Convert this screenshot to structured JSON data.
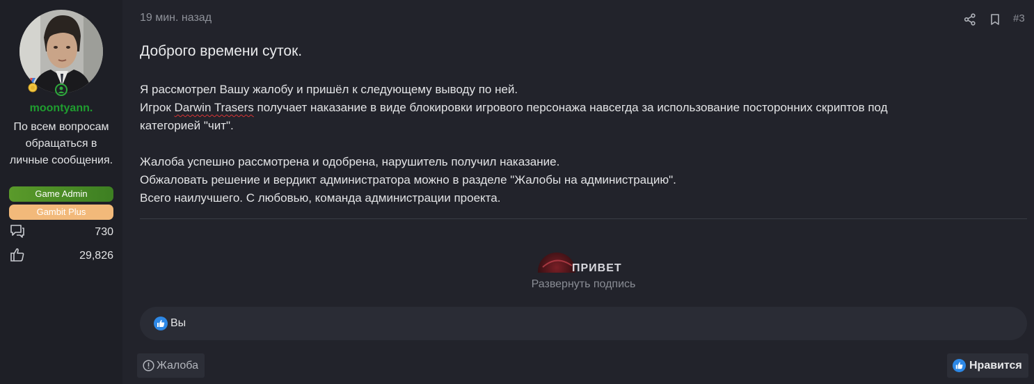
{
  "user": {
    "username": "moontyann.",
    "title": "По всем вопросам обращаться в личные сообщения.",
    "banners": {
      "admin": "Game Admin",
      "plus": "Gambit Plus"
    },
    "stats": {
      "messages": "730",
      "reactions": "29,826"
    },
    "colors": {
      "username": "#1f9d2f",
      "admin_banner": "#4a8c26",
      "plus_banner": "#f2b97a"
    }
  },
  "post": {
    "date": "19 мин. назад",
    "number": "#3",
    "greeting": "Доброго времени суток.",
    "line1": "Я рассмотрел Вашу жалобу и пришёл к следующему выводу по ней.",
    "line2_prefix": "Игрок ",
    "player_name": "Darwin Trasers",
    "line2_suffix": " получает наказание в виде блокировки игрового персонажа навсегда за использование посторонних скриптов под",
    "line3": "категорией \"чит\".",
    "line4": "Жалоба успешно рассмотрена и одобрена, нарушитель получил наказание.",
    "line5": "Обжаловать решение и вердикт администратора можно в разделе \"Жалобы на администрацию\".",
    "line6": "Всего наилучшего. С любовью, команда администрации проекта.",
    "signature_logo_text": "ПРИВЕТ",
    "expand_signature": "Развернуть подпись"
  },
  "reactions": {
    "users": "Вы"
  },
  "actions": {
    "report": "Жалоба",
    "like": "Нравится"
  },
  "icons": [
    "medal-icon",
    "online-status-icon",
    "messages-icon",
    "thumbs-up-icon",
    "share-icon",
    "bookmark-icon",
    "like-reaction-icon",
    "report-icon"
  ]
}
